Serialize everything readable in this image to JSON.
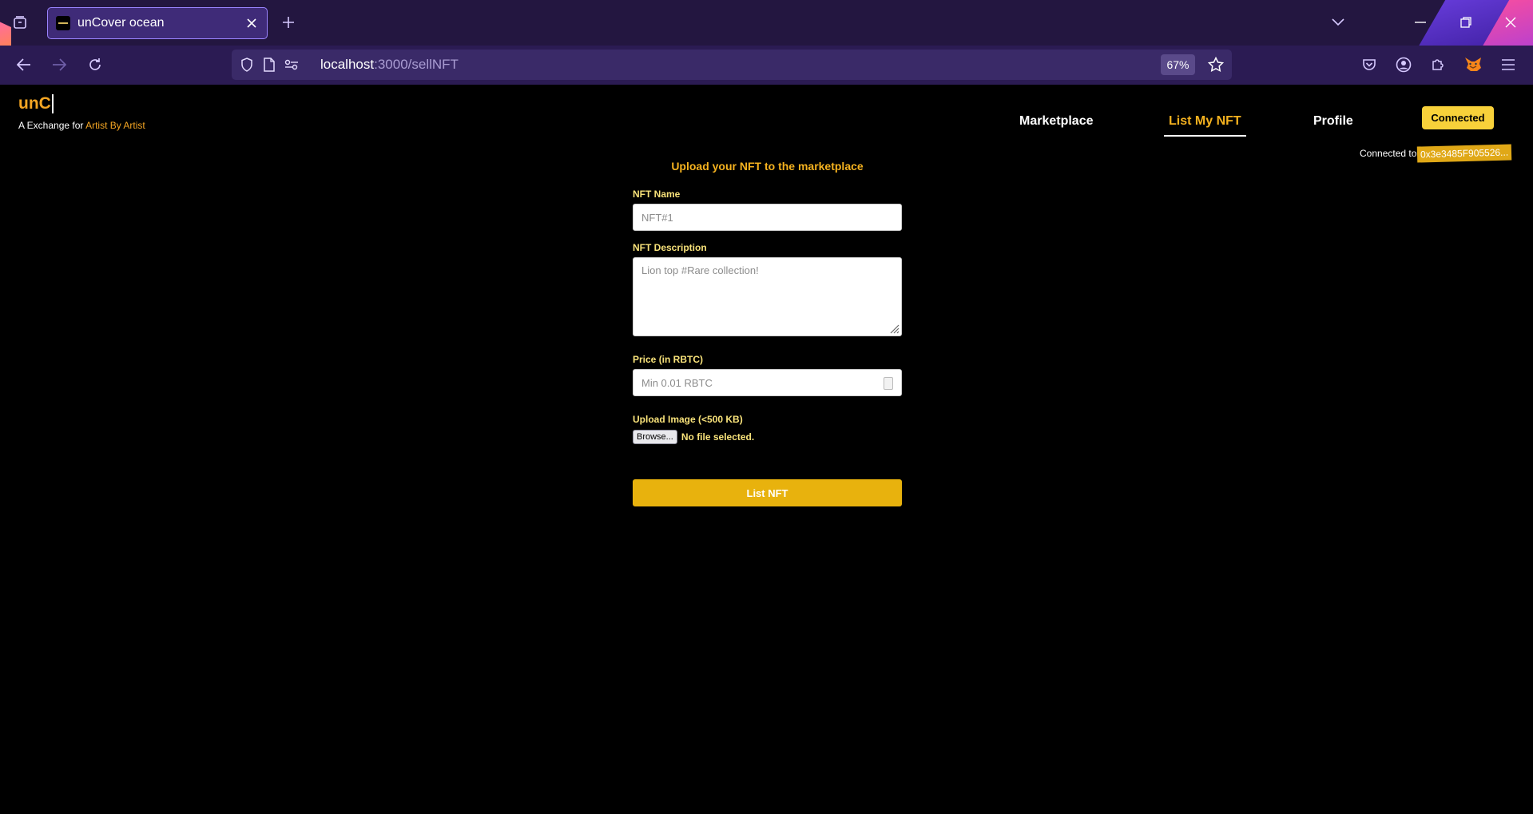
{
  "browser": {
    "tab_title": "unCover ocean",
    "url_host": "localhost",
    "url_rest": ":3000/sellNFT",
    "zoom": "67%"
  },
  "site": {
    "logo": "unC",
    "tagline_prefix": "A Exchange for ",
    "tagline_artist1": "Artist",
    "tagline_by": " By ",
    "tagline_artist2": "Artist"
  },
  "nav": {
    "marketplace": "Marketplace",
    "list_my_nft": "List My NFT",
    "profile": "Profile"
  },
  "wallet": {
    "button": "Connected",
    "connected_to": "Connected to",
    "address": "0x3e3485F905526..."
  },
  "form": {
    "title": "Upload your NFT to the marketplace",
    "name_label": "NFT Name",
    "name_placeholder": "NFT#1",
    "description_label": "NFT Description",
    "description_placeholder": "Lion top #Rare collection!",
    "price_label": "Price (in RBTC)",
    "price_placeholder": "Min 0.01 RBTC",
    "image_label": "Upload Image (<500 KB)",
    "browse_label": "Browse...",
    "file_status": "No file selected.",
    "submit_label": "List NFT"
  },
  "colors": {
    "accent": "#f5b21f",
    "button": "#e8b20d",
    "browser_tabbar": "#231640",
    "browser_navbar": "#2b1b53"
  }
}
